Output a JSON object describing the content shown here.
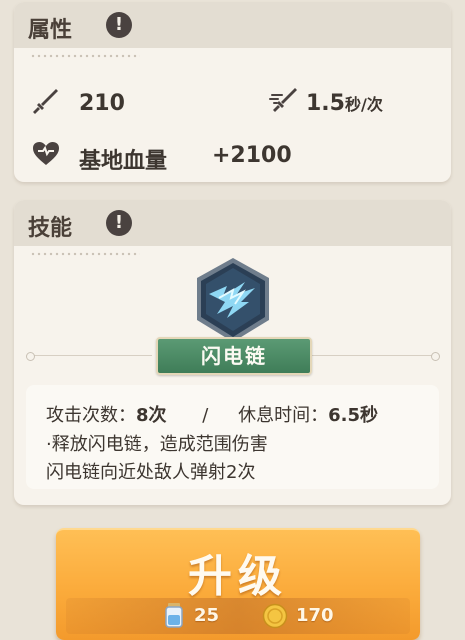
{
  "attributes": {
    "title": "属性",
    "info_icon": "!",
    "attack": "210",
    "attack_speed_value": "1.5",
    "attack_speed_unit": "秒/次",
    "base_hp_label": "基地血量",
    "base_hp_value": "+2100"
  },
  "skill": {
    "title": "技能",
    "info_icon": "!",
    "name": "闪电链",
    "hits_label": "攻击次数：",
    "hits_value": "8次",
    "separator": "/",
    "rest_label": "休息时间：",
    "rest_value": "6.5秒",
    "desc_line1": "·释放闪电链，造成范围伤害",
    "desc_line2": "闪电链向近处敌人弹射2次"
  },
  "upgrade": {
    "label": "升级",
    "cost_item": "25",
    "cost_coins": "170"
  },
  "colors": {
    "panel": "#f7f3ec",
    "header": "#e3ddd2",
    "skill_name_bg": "#4a8a63",
    "button": "#fbab3b",
    "badge": "#2b3f55"
  }
}
